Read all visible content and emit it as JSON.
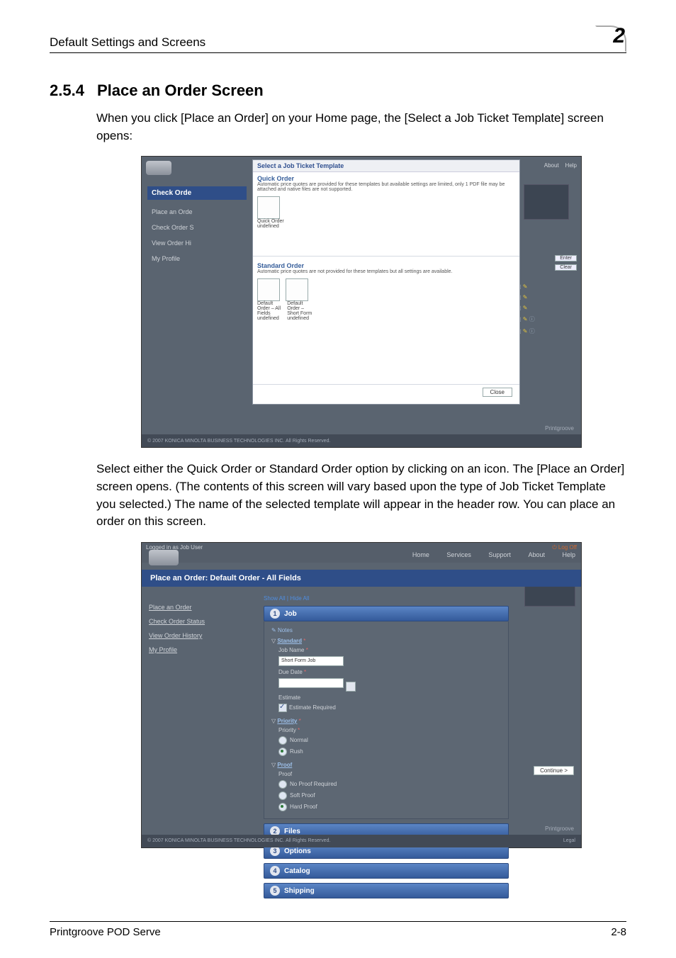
{
  "header": {
    "left": "Default Settings and Screens",
    "chapter": "2"
  },
  "section": {
    "number": "2.5.4",
    "title": "Place an Order Screen"
  },
  "para1": "When you click [Place an Order] on your Home page, the [Select a Job Ticket Template] screen opens:",
  "para2": "Select either the Quick Order or Standard Order option by clicking on an icon. The [Place an Order] screen opens. (The contents of this screen will vary based upon the type of Job Ticket Template you selected.) The name of the selected template will appear in the header row. You can place an order on this screen.",
  "footer": {
    "left": "Printgroove POD Serve",
    "right": "2-8"
  },
  "shot1": {
    "modal_title": "Select a Job Ticket Template",
    "quick_head": "Quick Order",
    "quick_sub": "Automatic price quotes are provided for these templates but available settings are limited, only 1 PDF file may be attached and native files are not supported.",
    "quick_label": "Quick Order",
    "quick_undef": "undefined",
    "standard_head": "Standard Order",
    "standard_sub": "Automatic price quotes are not provided for these templates but all settings are available.",
    "std_a1": "Default Order – All Fields",
    "std_a2": "undefined",
    "std_b1": "Default Order – Short Form",
    "std_b2": "undefined",
    "close": "Close",
    "banner": "Check Orde",
    "nav": {
      "place": "Place an Orde",
      "status": "Check Order S",
      "history": "View Order Hi",
      "profile": "My Profile"
    },
    "right": {
      "about": "About",
      "help": "Help",
      "enter": "Enter",
      "clear": "Clear"
    },
    "copyright": "© 2007 KONICA MINOLTA BUSINESS TECHNOLOGIES INC. All Rights Reserved.",
    "pg": "Printgroove"
  },
  "shot2": {
    "loggedin": "Logged in as Job User",
    "logoff": "Log Off",
    "topnav": {
      "home": "Home",
      "services": "Services",
      "support": "Support",
      "about": "About",
      "help": "Help"
    },
    "banner": "Place an Order: Default Order - All Fields",
    "leftnav": {
      "place": "Place an Order",
      "status": "Check Order Status",
      "history": "View Order History",
      "profile": "My Profile"
    },
    "links": {
      "showall": "Show All",
      "hideall": "Hide All"
    },
    "acc": {
      "job": "Job",
      "files": "Files",
      "options": "Options",
      "catalog": "Catalog",
      "shipping": "Shipping"
    },
    "acc_nums": {
      "job": "1",
      "files": "2",
      "options": "3",
      "catalog": "4",
      "shipping": "5"
    },
    "job": {
      "notes": "Notes",
      "standard": "Standard",
      "jobname_label": "Job Name",
      "jobname_value": "Short Form Job",
      "duedate": "Due Date",
      "estimate_head": "Estimate",
      "estimate_chk": "Estimate Required",
      "priority_head": "Priority",
      "priority_label": "Priority",
      "priority_normal": "Normal",
      "priority_rush": "Rush",
      "proof_head": "Proof",
      "proof_label": "Proof",
      "proof_none": "No Proof Required",
      "proof_soft": "Soft Proof",
      "proof_hard": "Hard Proof"
    },
    "continue": "Continue >",
    "copyright": "© 2007 KONICA MINOLTA BUSINESS TECHNOLOGIES INC. All Rights Reserved.",
    "legal": "Legal",
    "pg": "Printgroove"
  }
}
